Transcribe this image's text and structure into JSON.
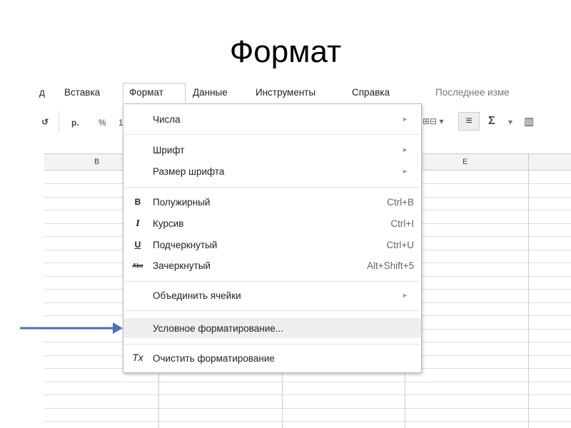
{
  "slide_title": "Формат",
  "menubar": {
    "partial": "д",
    "items": [
      "Вставка",
      "Формат",
      "Данные",
      "Инструменты",
      "Справка"
    ],
    "last_edit": "Последнее изме"
  },
  "toolbar": {
    "currency": "р.",
    "percent": "%",
    "decimals": "1",
    "sigma": "Σ"
  },
  "columns": [
    "B",
    "E"
  ],
  "menu": {
    "numbers": "Числа",
    "font": "Шрифт",
    "font_size": "Размер шрифта",
    "bold": {
      "icon": "B",
      "label": "Полужирный",
      "shortcut": "Ctrl+B"
    },
    "italic": {
      "icon": "I",
      "label": "Курсив",
      "shortcut": "Ctrl+I"
    },
    "underline": {
      "icon": "U",
      "label": "Подчеркнутый",
      "shortcut": "Ctrl+U"
    },
    "strike": {
      "icon": "Abc",
      "label": "Зачеркнутый",
      "shortcut": "Alt+Shift+5"
    },
    "merge": "Объединить ячейки",
    "conditional": "Условное форматирование...",
    "clear": {
      "icon": "Tx",
      "label": "Очистить форматирование"
    }
  },
  "colors": {
    "arrow": "#4a72b8"
  }
}
